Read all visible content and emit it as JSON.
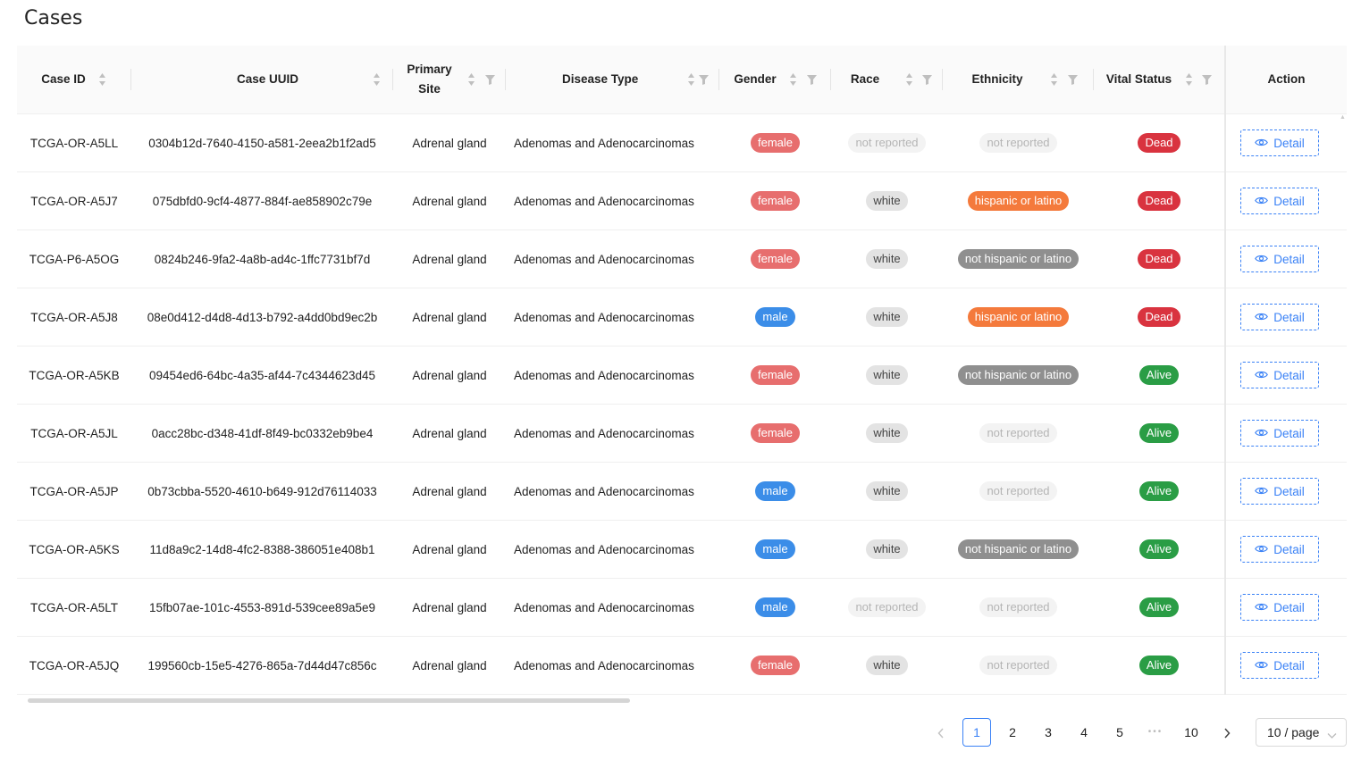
{
  "page": {
    "title": "Cases"
  },
  "columns": {
    "case_id": "Case ID",
    "case_uuid": "Case UUID",
    "primary_site": "Primary Site",
    "disease_type": "Disease Type",
    "gender": "Gender",
    "race": "Race",
    "ethnicity": "Ethnicity",
    "vital_status": "Vital Status",
    "action": "Action"
  },
  "rows": [
    {
      "case_id": "TCGA-OR-A5LL",
      "case_uuid": "0304b12d-7640-4150-a581-2eea2b1f2ad5",
      "primary_site": "Adrenal gland",
      "disease_type": "Adenomas and Adenocarcinomas",
      "gender": "female",
      "race": "not reported",
      "ethnicity": "not reported",
      "vital_status": "Dead",
      "action": "Detail"
    },
    {
      "case_id": "TCGA-OR-A5J7",
      "case_uuid": "075dbfd0-9cf4-4877-884f-ae858902c79e",
      "primary_site": "Adrenal gland",
      "disease_type": "Adenomas and Adenocarcinomas",
      "gender": "female",
      "race": "white",
      "ethnicity": "hispanic or latino",
      "vital_status": "Dead",
      "action": "Detail"
    },
    {
      "case_id": "TCGA-P6-A5OG",
      "case_uuid": "0824b246-9fa2-4a8b-ad4c-1ffc7731bf7d",
      "primary_site": "Adrenal gland",
      "disease_type": "Adenomas and Adenocarcinomas",
      "gender": "female",
      "race": "white",
      "ethnicity": "not hispanic or latino",
      "vital_status": "Dead",
      "action": "Detail"
    },
    {
      "case_id": "TCGA-OR-A5J8",
      "case_uuid": "08e0d412-d4d8-4d13-b792-a4dd0bd9ec2b",
      "primary_site": "Adrenal gland",
      "disease_type": "Adenomas and Adenocarcinomas",
      "gender": "male",
      "race": "white",
      "ethnicity": "hispanic or latino",
      "vital_status": "Dead",
      "action": "Detail"
    },
    {
      "case_id": "TCGA-OR-A5KB",
      "case_uuid": "09454ed6-64bc-4a35-af44-7c4344623d45",
      "primary_site": "Adrenal gland",
      "disease_type": "Adenomas and Adenocarcinomas",
      "gender": "female",
      "race": "white",
      "ethnicity": "not hispanic or latino",
      "vital_status": "Alive",
      "action": "Detail"
    },
    {
      "case_id": "TCGA-OR-A5JL",
      "case_uuid": "0acc28bc-d348-41df-8f49-bc0332eb9be4",
      "primary_site": "Adrenal gland",
      "disease_type": "Adenomas and Adenocarcinomas",
      "gender": "female",
      "race": "white",
      "ethnicity": "not reported",
      "vital_status": "Alive",
      "action": "Detail"
    },
    {
      "case_id": "TCGA-OR-A5JP",
      "case_uuid": "0b73cbba-5520-4610-b649-912d76114033",
      "primary_site": "Adrenal gland",
      "disease_type": "Adenomas and Adenocarcinomas",
      "gender": "male",
      "race": "white",
      "ethnicity": "not reported",
      "vital_status": "Alive",
      "action": "Detail"
    },
    {
      "case_id": "TCGA-OR-A5KS",
      "case_uuid": "11d8a9c2-14d8-4fc2-8388-386051e408b1",
      "primary_site": "Adrenal gland",
      "disease_type": "Adenomas and Adenocarcinomas",
      "gender": "male",
      "race": "white",
      "ethnicity": "not hispanic or latino",
      "vital_status": "Alive",
      "action": "Detail"
    },
    {
      "case_id": "TCGA-OR-A5LT",
      "case_uuid": "15fb07ae-101c-4553-891d-539cee89a5e9",
      "primary_site": "Adrenal gland",
      "disease_type": "Adenomas and Adenocarcinomas",
      "gender": "male",
      "race": "not reported",
      "ethnicity": "not reported",
      "vital_status": "Alive",
      "action": "Detail"
    },
    {
      "case_id": "TCGA-OR-A5JQ",
      "case_uuid": "199560cb-15e5-4276-865a-7d44d47c856c",
      "primary_site": "Adrenal gland",
      "disease_type": "Adenomas and Adenocarcinomas",
      "gender": "female",
      "race": "white",
      "ethnicity": "not reported",
      "vital_status": "Alive",
      "action": "Detail"
    }
  ],
  "pagination": {
    "prev_icon": "chevron-left-icon",
    "next_icon": "chevron-right-icon",
    "pages": [
      "1",
      "2",
      "3",
      "4",
      "5"
    ],
    "ellipsis": "•••",
    "last_page": "10",
    "current_page": "1",
    "page_size": "10 / page"
  },
  "colors": {
    "accent": "#3b82f6",
    "female": "#e76e6e",
    "male": "#3b8de8",
    "hispanic": "#f47a3c",
    "not_hispanic": "#8f8f8f",
    "dead": "#d9333f",
    "alive": "#2a9d45"
  }
}
